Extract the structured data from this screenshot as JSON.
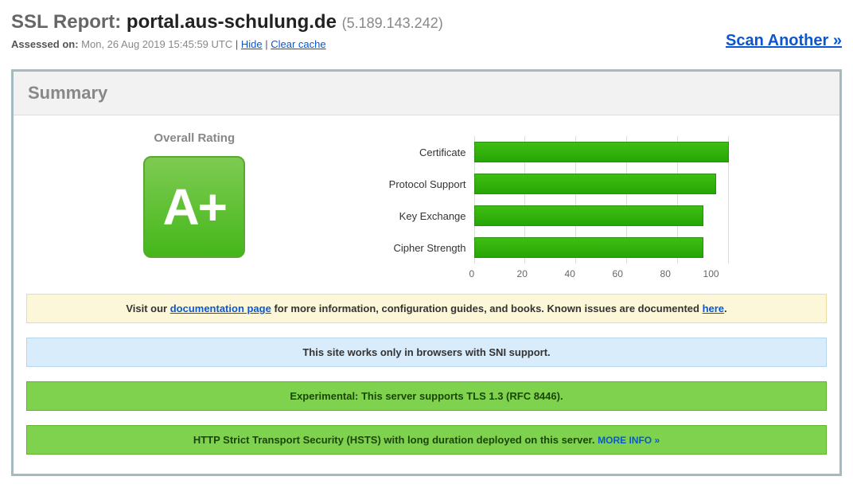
{
  "header": {
    "title_prefix": "SSL Report: ",
    "host": "portal.aus-schulung.de",
    "ip": "(5.189.143.242)",
    "assessed_label": "Assessed on:",
    "assessed_value": "Mon, 26 Aug 2019 15:45:59 UTC",
    "sep": " | ",
    "hide": "Hide",
    "clear_cache": "Clear cache",
    "scan_another": "Scan Another »"
  },
  "summary": {
    "heading": "Summary",
    "rating_label": "Overall Rating",
    "grade": "A+"
  },
  "chart_data": {
    "type": "bar",
    "categories": [
      "Certificate",
      "Protocol Support",
      "Key Exchange",
      "Cipher Strength"
    ],
    "values": [
      100,
      95,
      90,
      90
    ],
    "xlim": [
      0,
      100
    ],
    "ticks": [
      "0",
      "20",
      "40",
      "60",
      "80",
      "100"
    ]
  },
  "banners": {
    "docs_pre": "Visit our ",
    "docs_link": "documentation page",
    "docs_post": " for more information, configuration guides, and books. Known issues are documented ",
    "docs_here": "here",
    "docs_dot": ".",
    "sni": "This site works only in browsers with SNI support.",
    "tls13": "Experimental: This server supports TLS 1.3 (RFC 8446).",
    "hsts_text": "HTTP Strict Transport Security (HSTS) with long duration deployed on this server. ",
    "hsts_more": "MORE INFO »"
  }
}
